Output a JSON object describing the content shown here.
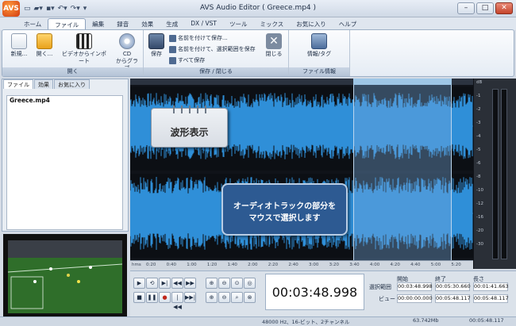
{
  "window": {
    "app_logo": "AVS",
    "title": "AVS Audio Editor ( Greece.mp4 )"
  },
  "menu_tabs": [
    "ホーム",
    "ファイル",
    "編集",
    "録音",
    "効果",
    "生成",
    "DX / VST",
    "ツール",
    "ミックス",
    "お気に入り",
    "ヘルプ"
  ],
  "active_menu_tab": "ファイル",
  "ribbon": {
    "groups": {
      "open": "開く",
      "save_close": "保存 / 閉じる",
      "file_info": "ファイル情報"
    },
    "buttons": {
      "new": "新規...",
      "open": "開く...",
      "import_video": "ビデオからインポート",
      "cd_grab_1": "CD",
      "cd_grab_2": "からグラブ",
      "save": "保存",
      "save_as": "名前を付けて保存...",
      "save_selection": "名前を付けて、選択範囲を保存",
      "save_all": "すべて保存",
      "close": "閉じる",
      "info_tag": "情報/タグ"
    }
  },
  "left_panel": {
    "tabs": [
      "ファイル",
      "効果",
      "お気に入り"
    ],
    "active_tab": "ファイル",
    "files": [
      "Greece.mp4"
    ]
  },
  "waveform": {
    "db_labels": [
      "dB",
      "-1",
      "-2",
      "-3",
      "-4",
      "-5",
      "-6",
      "-8",
      "-10",
      "-12",
      "-16",
      "-20",
      "-30"
    ],
    "ruler_unit": "hms",
    "ruler_ticks": [
      "0:20",
      "0:40",
      "1:00",
      "1:20",
      "1:40",
      "2:00",
      "2:20",
      "2:40",
      "3:00",
      "3:20",
      "3:40",
      "4:00",
      "4:20",
      "4:40",
      "5:00",
      "5:20"
    ]
  },
  "callouts": {
    "waveform_display": "波形表示",
    "select_line1": "オーディオトラックの部分を",
    "select_line2": "マウスで選択します"
  },
  "time_display": "00:03:48.998",
  "selection": {
    "col_start": "開始",
    "col_end": "終了",
    "col_length": "長さ",
    "row_selection": "選択範囲",
    "row_view": "ビュー",
    "sel_start": "00:03:48.998",
    "sel_end": "00:05:30.660",
    "sel_length": "00:01:41.663",
    "view_start": "00:00:00.000",
    "view_end": "00:05:48.117",
    "view_length": "00:05:48.117"
  },
  "status": {
    "format": "48000 Hz、16-ビット、2チャンネル",
    "size": "63.742Mb",
    "duration": "00:05:48.117"
  },
  "colors": {
    "wave": "#2f8fd8",
    "wave_bg": "#101319",
    "selection": "#9ec6e6",
    "callout_blue": "#2d5a92"
  }
}
